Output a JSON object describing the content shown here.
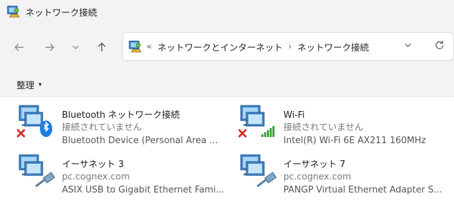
{
  "window": {
    "title": "ネットワーク接続",
    "title_icon": "network-connections-icon"
  },
  "nav": {
    "back_icon": "arrow-left-icon",
    "forward_icon": "arrow-right-icon",
    "recent_icon": "chevron-down-icon",
    "up_icon": "arrow-up-icon"
  },
  "address": {
    "overflow": "«",
    "crumbs": [
      "ネットワークとインターネット",
      "ネットワーク接続"
    ],
    "separator": "›",
    "dropdown_icon": "chevron-down-icon",
    "refresh_icon": "refresh-icon"
  },
  "toolbar": {
    "organize_label": "整理",
    "organize_caret": "▾"
  },
  "connections": [
    {
      "name": "Bluetooth ネットワーク接続",
      "status": "接続されていません",
      "device": "Bluetooth Device (Personal Area ...",
      "icon": "bluetooth-adapter-icon",
      "badge": "disconnected-x-icon"
    },
    {
      "name": "Wi-Fi",
      "status": "接続されていません",
      "device": "Intel(R) Wi-Fi 6E AX211 160MHz",
      "icon": "wifi-adapter-icon",
      "badge": "disconnected-x-icon"
    },
    {
      "name": "イーサネット 3",
      "status": "pc.cognex.com",
      "device": "ASIX USB to Gigabit Ethernet Fami...",
      "icon": "ethernet-adapter-icon",
      "badge": ""
    },
    {
      "name": "イーサネット 7",
      "status": "pc.cognex.com",
      "device": "PANGP Virtual Ethernet Adapter S...",
      "icon": "ethernet-adapter-icon",
      "badge": ""
    }
  ],
  "colors": {
    "chrome_bg": "#f3f3f3",
    "bluetooth": "#1e7be0",
    "error_x": "#d0312d",
    "wifi_bars": "#3aa33a"
  }
}
